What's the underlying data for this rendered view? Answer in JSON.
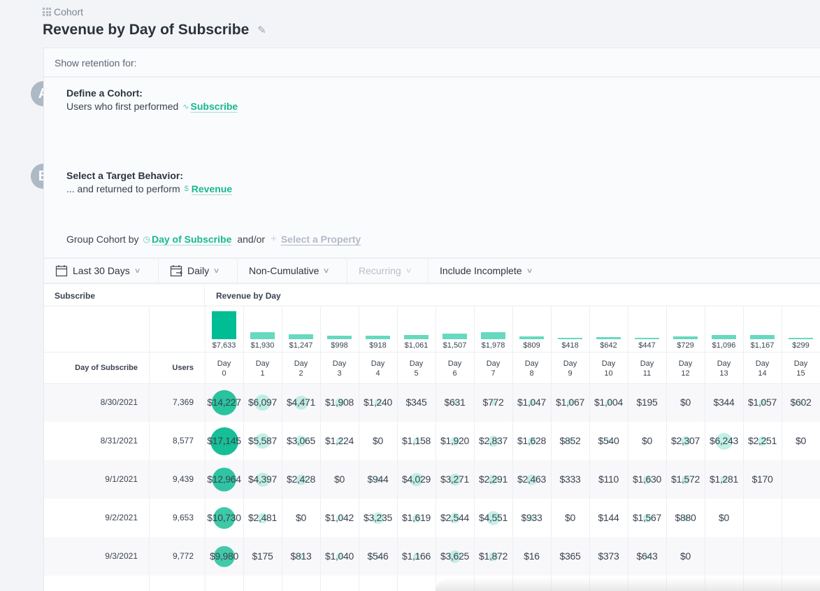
{
  "breadcrumb": {
    "icon": "grid-icon",
    "label": "Cohort"
  },
  "page_title": "Revenue by Day of Subscribe",
  "query": {
    "show_retention_label": "Show retention for:",
    "step_a": {
      "badge": "A",
      "heading": "Define a Cohort:",
      "prefix": "Users who first performed",
      "event_icon": "event-pulse-icon",
      "event": "Subscribe"
    },
    "step_b": {
      "badge": "B",
      "heading": "Select a Target Behavior:",
      "prefix": "... and returned to perform",
      "event_icon": "dollar-icon",
      "event": "Revenue"
    },
    "group_by": {
      "prefix": "Group Cohort by",
      "property_icon": "clock-icon",
      "property": "Day of Subscribe",
      "conjunction": "and/or",
      "add_placeholder": "Select a Property"
    }
  },
  "toolbar": {
    "date_range": "Last 30 Days",
    "interval": "Daily",
    "mode": "Non-Cumulative",
    "recurring": "Recurring",
    "incomplete": "Include Incomplete"
  },
  "table": {
    "left_header": "Subscribe",
    "right_header": "Revenue by Day",
    "col_date": "Day of Subscribe",
    "col_users": "Users",
    "day_label": "Day",
    "days": [
      "0",
      "1",
      "2",
      "3",
      "4",
      "5",
      "6",
      "7",
      "8",
      "9",
      "10",
      "11",
      "12",
      "13",
      "14",
      "15"
    ],
    "day_totals": [
      "$7,633",
      "$1,930",
      "$1,247",
      "$998",
      "$918",
      "$1,061",
      "$1,507",
      "$1,978",
      "$809",
      "$418",
      "$642",
      "$447",
      "$729",
      "$1,096",
      "$1,167",
      "$299"
    ],
    "day_total_values": [
      7633,
      1930,
      1247,
      998,
      918,
      1061,
      1507,
      1978,
      809,
      418,
      642,
      447,
      729,
      1096,
      1167,
      299
    ],
    "rows": [
      {
        "date": "8/30/2021",
        "users": "7,369",
        "values": [
          "$14,227",
          "$6,097",
          "$4,471",
          "$1,908",
          "$1,240",
          "$345",
          "$631",
          "$772",
          "$1,047",
          "$1,067",
          "$1,004",
          "$195",
          "$0",
          "$344",
          "$1,057",
          "$602"
        ]
      },
      {
        "date": "8/31/2021",
        "users": "8,577",
        "values": [
          "$17,145",
          "$5,587",
          "$3,065",
          "$1,224",
          "$0",
          "$1,158",
          "$1,920",
          "$2,837",
          "$1,628",
          "$852",
          "$540",
          "$0",
          "$2,307",
          "$6,243",
          "$2,251",
          "$0"
        ]
      },
      {
        "date": "9/1/2021",
        "users": "9,439",
        "values": [
          "$12,964",
          "$4,397",
          "$2,428",
          "$0",
          "$944",
          "$4,029",
          "$3,271",
          "$2,291",
          "$2,463",
          "$333",
          "$110",
          "$1,630",
          "$1,572",
          "$1,281",
          "$170",
          ""
        ]
      },
      {
        "date": "9/2/2021",
        "users": "9,653",
        "values": [
          "$10,730",
          "$2,481",
          "$0",
          "$1,042",
          "$3,235",
          "$1,619",
          "$2,544",
          "$4,551",
          "$933",
          "$0",
          "$144",
          "$1,567",
          "$880",
          "$0",
          "",
          ""
        ]
      },
      {
        "date": "9/3/2021",
        "users": "9,772",
        "values": [
          "$9,980",
          "$175",
          "$813",
          "$1,040",
          "$546",
          "$1,166",
          "$3,625",
          "$1,872",
          "$16",
          "$365",
          "$373",
          "$643",
          "$0",
          "",
          "",
          ""
        ]
      }
    ]
  },
  "colors": {
    "accent": "#17b890",
    "bar": "#66d9c0",
    "bar_max": "#00bd94",
    "bubble": "#3ccaa6"
  }
}
